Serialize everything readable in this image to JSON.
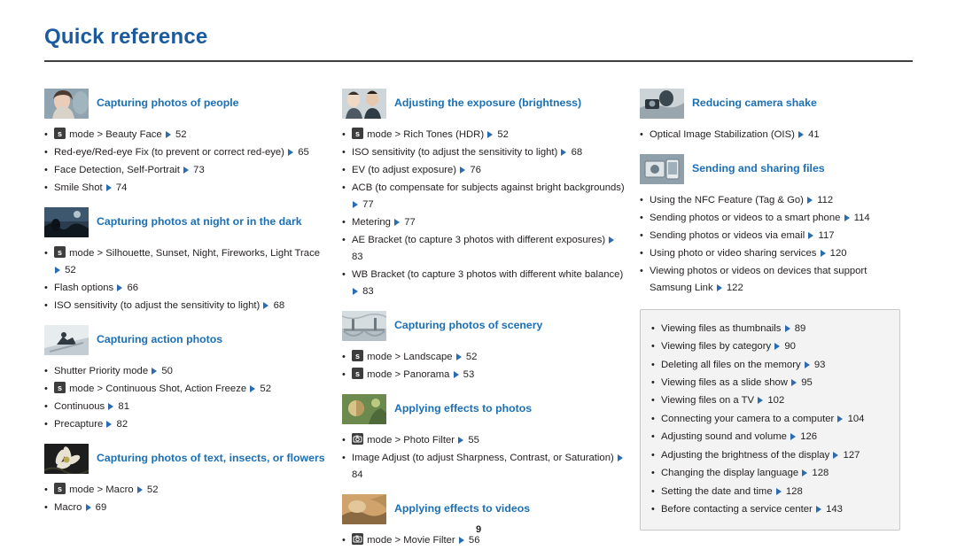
{
  "page": {
    "title": "Quick reference",
    "page_number": "9"
  },
  "columns": [
    {
      "sections": [
        {
          "title": "Capturing photos of people",
          "thumb": "portrait-woman-photo",
          "items": [
            [
              {
                "t": "icon",
                "v": "scene-mode-icon"
              },
              {
                "t": "text",
                "v": " mode > Beauty Face "
              },
              {
                "t": "arrow"
              },
              {
                "t": "text",
                "v": " 52"
              }
            ],
            [
              {
                "t": "text",
                "v": "Red-eye/Red-eye Fix (to prevent or correct red-eye) "
              },
              {
                "t": "arrow"
              },
              {
                "t": "text",
                "v": " 65"
              }
            ],
            [
              {
                "t": "text",
                "v": "Face Detection, Self-Portrait "
              },
              {
                "t": "arrow"
              },
              {
                "t": "text",
                "v": " 73"
              }
            ],
            [
              {
                "t": "text",
                "v": "Smile Shot "
              },
              {
                "t": "arrow"
              },
              {
                "t": "text",
                "v": " 74"
              }
            ]
          ]
        },
        {
          "title": "Capturing photos at night or in the dark",
          "thumb": "night-silhouette-photo",
          "items": [
            [
              {
                "t": "icon",
                "v": "scene-mode-icon"
              },
              {
                "t": "text",
                "v": " mode > Silhouette, Sunset, Night, Fireworks, Light Trace "
              },
              {
                "t": "arrow"
              },
              {
                "t": "text",
                "v": " 52"
              }
            ],
            [
              {
                "t": "text",
                "v": "Flash options "
              },
              {
                "t": "arrow"
              },
              {
                "t": "text",
                "v": " 66"
              }
            ],
            [
              {
                "t": "text",
                "v": "ISO sensitivity (to adjust the sensitivity to light) "
              },
              {
                "t": "arrow"
              },
              {
                "t": "text",
                "v": " 68"
              }
            ]
          ]
        },
        {
          "title": "Capturing action photos",
          "thumb": "action-sports-photo",
          "items": [
            [
              {
                "t": "text",
                "v": "Shutter Priority mode "
              },
              {
                "t": "arrow"
              },
              {
                "t": "text",
                "v": " 50"
              }
            ],
            [
              {
                "t": "icon",
                "v": "scene-mode-icon"
              },
              {
                "t": "text",
                "v": " mode > Continuous Shot, Action Freeze "
              },
              {
                "t": "arrow"
              },
              {
                "t": "text",
                "v": " 52"
              }
            ],
            [
              {
                "t": "text",
                "v": "Continuous "
              },
              {
                "t": "arrow"
              },
              {
                "t": "text",
                "v": " 81"
              }
            ],
            [
              {
                "t": "text",
                "v": "Precapture "
              },
              {
                "t": "arrow"
              },
              {
                "t": "text",
                "v": " 82"
              }
            ]
          ]
        },
        {
          "title": "Capturing photos of text, insects, or flowers",
          "thumb": "macro-flower-photo",
          "items": [
            [
              {
                "t": "icon",
                "v": "scene-mode-icon"
              },
              {
                "t": "text",
                "v": " mode > Macro "
              },
              {
                "t": "arrow"
              },
              {
                "t": "text",
                "v": " 52"
              }
            ],
            [
              {
                "t": "text",
                "v": "Macro "
              },
              {
                "t": "arrow"
              },
              {
                "t": "text",
                "v": " 69"
              }
            ]
          ]
        }
      ]
    },
    {
      "sections": [
        {
          "title": "Adjusting the exposure (brightness)",
          "thumb": "exposure-portraits-photo",
          "items": [
            [
              {
                "t": "icon",
                "v": "scene-mode-icon"
              },
              {
                "t": "text",
                "v": " mode > Rich Tones (HDR) "
              },
              {
                "t": "arrow"
              },
              {
                "t": "text",
                "v": " 52"
              }
            ],
            [
              {
                "t": "text",
                "v": "ISO sensitivity (to adjust the sensitivity to light) "
              },
              {
                "t": "arrow"
              },
              {
                "t": "text",
                "v": " 68"
              }
            ],
            [
              {
                "t": "text",
                "v": "EV (to adjust exposure) "
              },
              {
                "t": "arrow"
              },
              {
                "t": "text",
                "v": " 76"
              }
            ],
            [
              {
                "t": "text",
                "v": "ACB (to compensate for subjects against bright backgrounds) "
              },
              {
                "t": "arrow"
              },
              {
                "t": "text",
                "v": " 77"
              }
            ],
            [
              {
                "t": "text",
                "v": "Metering "
              },
              {
                "t": "arrow"
              },
              {
                "t": "text",
                "v": " 77"
              }
            ],
            [
              {
                "t": "text",
                "v": "AE Bracket (to capture 3 photos with different exposures) "
              },
              {
                "t": "arrow"
              },
              {
                "t": "text",
                "v": " 83"
              }
            ],
            [
              {
                "t": "text",
                "v": "WB Bracket (to capture 3 photos with different white balance) "
              },
              {
                "t": "arrow"
              },
              {
                "t": "text",
                "v": " 83"
              }
            ]
          ]
        },
        {
          "title": "Capturing photos of scenery",
          "thumb": "landscape-bridge-photo",
          "items": [
            [
              {
                "t": "icon",
                "v": "scene-mode-icon"
              },
              {
                "t": "text",
                "v": " mode > Landscape "
              },
              {
                "t": "arrow"
              },
              {
                "t": "text",
                "v": " 52"
              }
            ],
            [
              {
                "t": "icon",
                "v": "scene-mode-icon"
              },
              {
                "t": "text",
                "v": " mode > Panorama "
              },
              {
                "t": "arrow"
              },
              {
                "t": "text",
                "v": " 53"
              }
            ]
          ]
        },
        {
          "title": "Applying effects to photos",
          "thumb": "photo-filter-effect-photo",
          "items": [
            [
              {
                "t": "icon",
                "v": "smart-auto-icon"
              },
              {
                "t": "text",
                "v": " mode > Photo Filter "
              },
              {
                "t": "arrow"
              },
              {
                "t": "text",
                "v": " 55"
              }
            ],
            [
              {
                "t": "text",
                "v": "Image Adjust (to adjust Sharpness, Contrast, or Saturation) "
              },
              {
                "t": "arrow"
              },
              {
                "t": "text",
                "v": " 84"
              }
            ]
          ]
        },
        {
          "title": "Applying effects to videos",
          "thumb": "movie-filter-effect-photo",
          "items": [
            [
              {
                "t": "icon",
                "v": "smart-auto-icon"
              },
              {
                "t": "text",
                "v": " mode > Movie Filter "
              },
              {
                "t": "arrow"
              },
              {
                "t": "text",
                "v": " 56"
              }
            ]
          ]
        }
      ]
    },
    {
      "sections": [
        {
          "title": "Reducing camera shake",
          "thumb": "camera-shake-photo",
          "items": [
            [
              {
                "t": "text",
                "v": "Optical Image Stabilization (OIS) "
              },
              {
                "t": "arrow"
              },
              {
                "t": "text",
                "v": " 41"
              }
            ]
          ]
        },
        {
          "title": "Sending and sharing files",
          "thumb": "sharing-files-photo",
          "items": [
            [
              {
                "t": "text",
                "v": "Using the NFC Feature (Tag & Go) "
              },
              {
                "t": "arrow"
              },
              {
                "t": "text",
                "v": " 112"
              }
            ],
            [
              {
                "t": "text",
                "v": "Sending photos or videos to a smart phone "
              },
              {
                "t": "arrow"
              },
              {
                "t": "text",
                "v": " 114"
              }
            ],
            [
              {
                "t": "text",
                "v": "Sending photos or videos via email "
              },
              {
                "t": "arrow"
              },
              {
                "t": "text",
                "v": " 117"
              }
            ],
            [
              {
                "t": "text",
                "v": "Using photo or video sharing services "
              },
              {
                "t": "arrow"
              },
              {
                "t": "text",
                "v": " 120"
              }
            ],
            [
              {
                "t": "text",
                "v": "Viewing photos or videos on devices that support Samsung Link "
              },
              {
                "t": "arrow"
              },
              {
                "t": "text",
                "v": " 122"
              }
            ]
          ]
        }
      ],
      "panel": {
        "items": [
          [
            {
              "t": "text",
              "v": "Viewing files as thumbnails "
            },
            {
              "t": "arrow"
            },
            {
              "t": "text",
              "v": " 89"
            }
          ],
          [
            {
              "t": "text",
              "v": "Viewing files by category "
            },
            {
              "t": "arrow"
            },
            {
              "t": "text",
              "v": " 90"
            }
          ],
          [
            {
              "t": "text",
              "v": "Deleting all files on the memory "
            },
            {
              "t": "arrow"
            },
            {
              "t": "text",
              "v": " 93"
            }
          ],
          [
            {
              "t": "text",
              "v": "Viewing files as a slide show "
            },
            {
              "t": "arrow"
            },
            {
              "t": "text",
              "v": " 95"
            }
          ],
          [
            {
              "t": "text",
              "v": "Viewing files on a TV "
            },
            {
              "t": "arrow"
            },
            {
              "t": "text",
              "v": " 102"
            }
          ],
          [
            {
              "t": "text",
              "v": "Connecting your camera to a computer "
            },
            {
              "t": "arrow"
            },
            {
              "t": "text",
              "v": " 104"
            }
          ],
          [
            {
              "t": "text",
              "v": "Adjusting sound and volume "
            },
            {
              "t": "arrow"
            },
            {
              "t": "text",
              "v": " 126"
            }
          ],
          [
            {
              "t": "text",
              "v": "Adjusting the brightness of the display "
            },
            {
              "t": "arrow"
            },
            {
              "t": "text",
              "v": " 127"
            }
          ],
          [
            {
              "t": "text",
              "v": "Changing the display language "
            },
            {
              "t": "arrow"
            },
            {
              "t": "text",
              "v": " 128"
            }
          ],
          [
            {
              "t": "text",
              "v": "Setting the date and time "
            },
            {
              "t": "arrow"
            },
            {
              "t": "text",
              "v": " 128"
            }
          ],
          [
            {
              "t": "text",
              "v": "Before contacting a service center "
            },
            {
              "t": "arrow"
            },
            {
              "t": "text",
              "v": " 143"
            }
          ]
        ]
      }
    }
  ],
  "colors": {
    "heading": "#1c5a9e",
    "section_title": "#1b6fb5",
    "body_text": "#231f20",
    "arrow": "#2b6cb0",
    "panel_bg": "#f3f3f3",
    "panel_border": "#c9c9c9"
  }
}
